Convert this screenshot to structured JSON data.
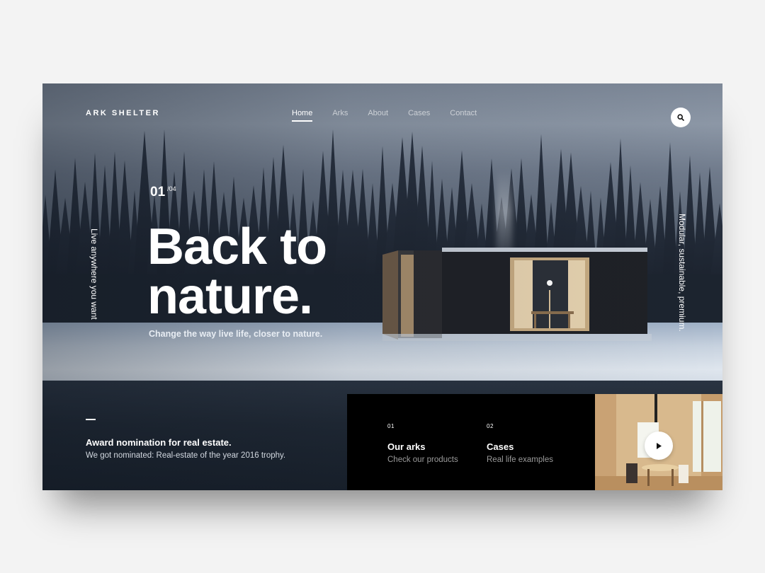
{
  "brand": {
    "name": "ARK SHELTER"
  },
  "nav": {
    "items": [
      {
        "label": "Home",
        "active": true
      },
      {
        "label": "Arks",
        "active": false
      },
      {
        "label": "About",
        "active": false
      },
      {
        "label": "Cases",
        "active": false
      },
      {
        "label": "Contact",
        "active": false
      }
    ],
    "search_icon": "search-icon"
  },
  "hero": {
    "counter_current": "01",
    "counter_total": "/04",
    "title_line1": "Back to",
    "title_line2": "nature.",
    "subtitle": "Change the way live life, closer to nature.",
    "side_left": "Live anywhere you want",
    "side_right": "Modular, sustainable, premium."
  },
  "award": {
    "title": "Award nomination for real estate.",
    "text": "We got nominated: Real-estate of the year 2016 trophy."
  },
  "cards": [
    {
      "num": "01",
      "title": "Our arks",
      "desc": "Check our products"
    },
    {
      "num": "02",
      "title": "Cases",
      "desc": "Real life examples"
    }
  ],
  "media": {
    "icon": "play-icon"
  },
  "colors": {
    "accent": "#ffffff",
    "panel": "#000000"
  }
}
